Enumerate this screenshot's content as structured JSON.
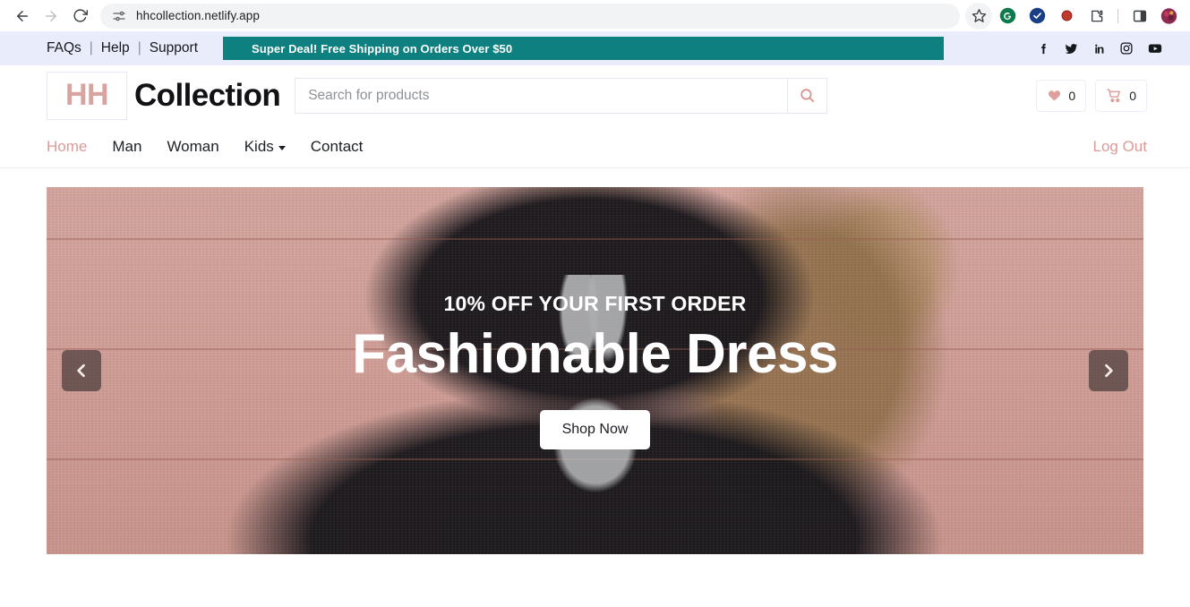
{
  "browser": {
    "url": "hhcollection.netlify.app",
    "back_label": "Back",
    "forward_label": "Forward",
    "reload_label": "Reload",
    "site_info_label": "site-settings",
    "bookmark_label": "Bookmark this tab",
    "extensions": [
      {
        "name": "grammarly-extension-icon",
        "color": "#0d7a4e",
        "glyph": "G"
      },
      {
        "name": "verified-extension-icon",
        "color": "#1b3f87",
        "glyph": "✓"
      },
      {
        "name": "recorder-extension-icon",
        "color": "#c0392b",
        "glyph": ""
      },
      {
        "name": "extensions-puzzle-icon",
        "color": "#3c4043",
        "glyph": ""
      },
      {
        "name": "side-panel-icon",
        "color": "#3c4043",
        "glyph": ""
      },
      {
        "name": "profile-avatar",
        "color": "#8e2b52",
        "glyph": ""
      }
    ]
  },
  "topbar": {
    "links": [
      "FAQs",
      "Help",
      "Support"
    ],
    "separator": "|",
    "deal_text": "Super Deal! Free Shipping on Orders Over $50",
    "deal_bg": "#0e8080",
    "bar_bg": "#e9ecfb",
    "social": [
      {
        "name": "facebook-icon",
        "label": "Facebook"
      },
      {
        "name": "twitter-icon",
        "label": "Twitter"
      },
      {
        "name": "linkedin-icon",
        "label": "LinkedIn"
      },
      {
        "name": "instagram-icon",
        "label": "Instagram"
      },
      {
        "name": "youtube-icon",
        "label": "YouTube"
      }
    ]
  },
  "header": {
    "logo_mark": "HH",
    "logo_text": "Collection",
    "logo_color": "#d9a3a0",
    "search": {
      "placeholder": "Search for products",
      "value": "",
      "button_label": "Search"
    },
    "wishlist": {
      "label": "Wishlist",
      "count": "0"
    },
    "cart": {
      "label": "Cart",
      "count": "0"
    },
    "accent_color": "#dfa09d"
  },
  "nav": {
    "items": [
      {
        "label": "Home",
        "active": true,
        "has_dropdown": false
      },
      {
        "label": "Man",
        "active": false,
        "has_dropdown": false
      },
      {
        "label": "Woman",
        "active": false,
        "has_dropdown": false
      },
      {
        "label": "Kids",
        "active": false,
        "has_dropdown": true
      },
      {
        "label": "Contact",
        "active": false,
        "has_dropdown": false
      }
    ],
    "logout_label": "Log Out",
    "active_color": "#dd9a97"
  },
  "hero": {
    "kicker": "10% OFF YOUR FIRST ORDER",
    "title": "Fashionable Dress",
    "cta_label": "Shop Now",
    "prev_label": "Previous slide",
    "next_label": "Next slide",
    "background_color": "#ce9b93"
  }
}
